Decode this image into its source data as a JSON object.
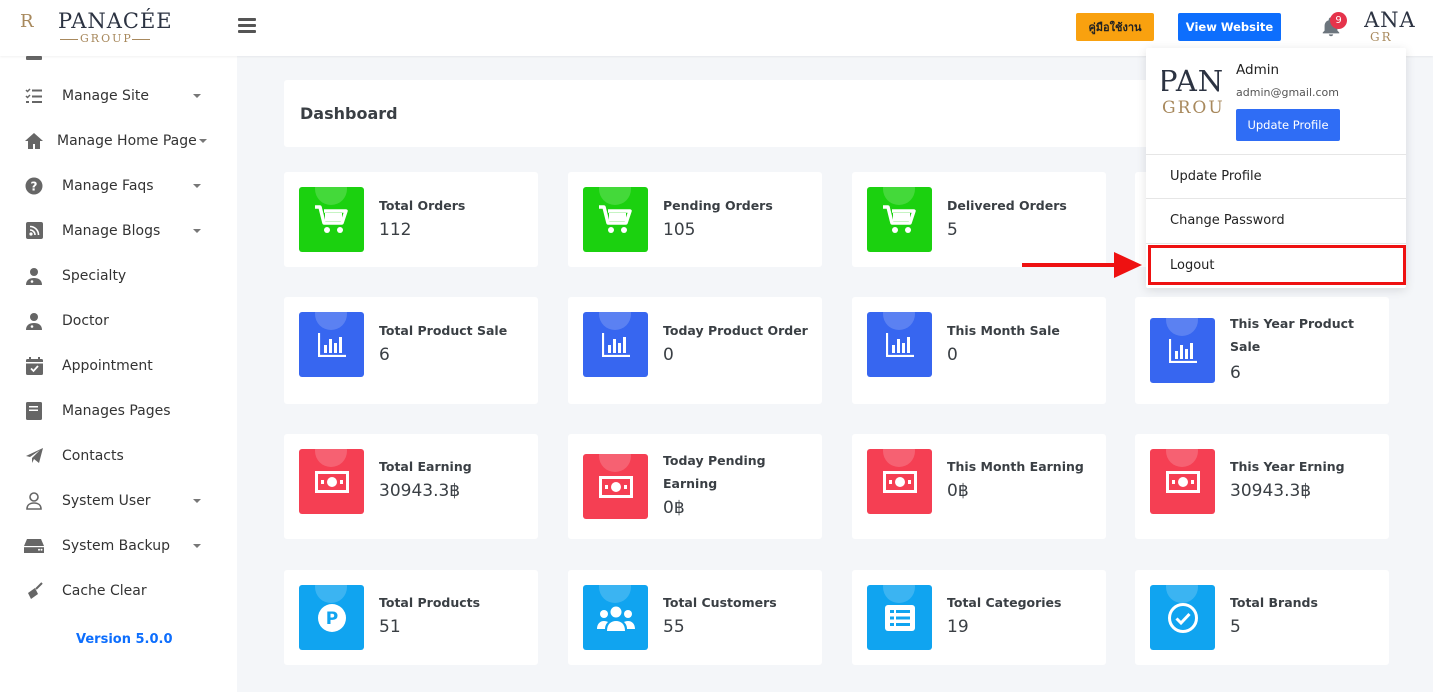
{
  "brand": {
    "monogram": "R",
    "wordmark": "PANACÉE",
    "group": "GROUP"
  },
  "header": {
    "manual_label": "คู่มือใช้งาน",
    "view_website_label": "View Website",
    "notification_count": "9",
    "avatar_wordmark": "ANA",
    "avatar_group": "GR"
  },
  "sidebar": {
    "items": [
      {
        "label": "Manage Site",
        "icon": "checklist-icon",
        "has_caret": true
      },
      {
        "label": "Manage Home Page",
        "icon": "home-icon",
        "has_caret": true
      },
      {
        "label": "Manage Faqs",
        "icon": "question-circle-icon",
        "has_caret": true
      },
      {
        "label": "Manage Blogs",
        "icon": "rss-icon",
        "has_caret": true
      },
      {
        "label": "Specialty",
        "icon": "user-doctor-icon",
        "has_caret": false
      },
      {
        "label": "Doctor",
        "icon": "user-doctor-icon",
        "has_caret": false
      },
      {
        "label": "Appointment",
        "icon": "calendar-check-icon",
        "has_caret": false
      },
      {
        "label": "Manages Pages",
        "icon": "book-icon",
        "has_caret": false
      },
      {
        "label": "Contacts",
        "icon": "paper-plane-icon",
        "has_caret": false
      },
      {
        "label": "System User",
        "icon": "user-icon",
        "has_caret": true
      },
      {
        "label": "System Backup",
        "icon": "hdd-icon",
        "has_caret": true
      },
      {
        "label": "Cache Clear",
        "icon": "broom-icon",
        "has_caret": false
      }
    ],
    "version": "Version 5.0.0"
  },
  "main": {
    "page_title": "Dashboard",
    "cards": [
      {
        "label": "Total Orders",
        "value": "112",
        "icon": "cart-icon",
        "color": "#1bd10f"
      },
      {
        "label": "Pending Orders",
        "value": "105",
        "icon": "cart-icon",
        "color": "#1bd10f"
      },
      {
        "label": "Delivered Orders",
        "value": "5",
        "icon": "cart-icon",
        "color": "#1bd10f"
      },
      {
        "label": "Total Product Sale",
        "value": "6",
        "icon": "chart-bar-icon",
        "color": "#3766f0"
      },
      {
        "label": "Today Product Order",
        "value": "0",
        "icon": "chart-bar-icon",
        "color": "#3766f0"
      },
      {
        "label": "This Month Sale",
        "value": "0",
        "icon": "chart-bar-icon",
        "color": "#3766f0"
      },
      {
        "label": "This Year Product Sale",
        "value": "6",
        "icon": "chart-bar-icon",
        "color": "#3766f0"
      },
      {
        "label": "Total Earning",
        "value": "30943.3฿",
        "icon": "money-bill-icon",
        "color": "#f53f53"
      },
      {
        "label": "Today Pending Earning",
        "value": "0฿",
        "icon": "money-bill-icon",
        "color": "#f53f53"
      },
      {
        "label": "This Month Earning",
        "value": "0฿",
        "icon": "money-bill-icon",
        "color": "#f53f53"
      },
      {
        "label": "This Year Erning",
        "value": "30943.3฿",
        "icon": "money-bill-icon",
        "color": "#f53f53"
      },
      {
        "label": "Total Products",
        "value": "51",
        "icon": "parking-icon",
        "color": "#10a4f0"
      },
      {
        "label": "Total Customers",
        "value": "55",
        "icon": "users-icon",
        "color": "#10a4f0"
      },
      {
        "label": "Total Categories",
        "value": "19",
        "icon": "list-alt-icon",
        "color": "#10a4f0"
      },
      {
        "label": "Total Brands",
        "value": "5",
        "icon": "check-circle-icon",
        "color": "#10a4f0"
      }
    ]
  },
  "profile_menu": {
    "name": "Admin",
    "email": "admin@gmail.com",
    "update_button_label": "Update Profile",
    "logo_wordmark": "PANA",
    "logo_group": "GROU",
    "items": [
      "Update Profile",
      "Change Password",
      "Logout"
    ]
  },
  "annotation": {
    "color": "#ee1111"
  }
}
